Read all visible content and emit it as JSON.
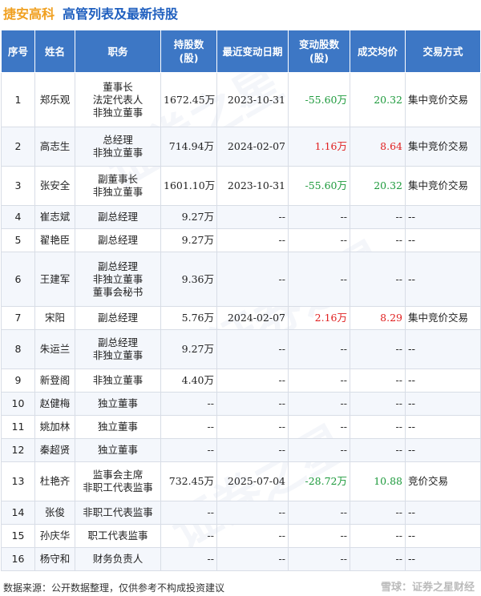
{
  "header": {
    "company": "捷安高科",
    "subtitle": "高管列表及最新持股"
  },
  "columns": [
    "序号",
    "姓名",
    "职务",
    "持股数\n(股)",
    "最近变动日期",
    "变动股数\n(股)",
    "成交均价",
    "交易方式"
  ],
  "rows": [
    {
      "idx": "1",
      "name": "郑乐观",
      "duties": "董事长\n法定代表人\n非独立董事",
      "shares": "1672.45万",
      "date": "2023-10-31",
      "chg": "-55.60万",
      "chg_sign": "neg",
      "price": "20.32",
      "method": "集中竞价交易"
    },
    {
      "idx": "2",
      "name": "高志生",
      "duties": "总经理\n非独立董事",
      "shares": "714.94万",
      "date": "2024-02-07",
      "chg": "1.16万",
      "chg_sign": "pos",
      "price": "8.64",
      "method": "集中竞价交易"
    },
    {
      "idx": "3",
      "name": "张安全",
      "duties": "副董事长\n非独立董事",
      "shares": "1601.10万",
      "date": "2023-10-31",
      "chg": "-55.60万",
      "chg_sign": "neg",
      "price": "20.32",
      "method": "集中竞价交易"
    },
    {
      "idx": "4",
      "name": "崔志斌",
      "duties": "副总经理",
      "shares": "9.27万",
      "date": "--",
      "chg": "--",
      "chg_sign": "none",
      "price": "--",
      "method": "--"
    },
    {
      "idx": "5",
      "name": "翟艳臣",
      "duties": "副总经理",
      "shares": "9.27万",
      "date": "--",
      "chg": "--",
      "chg_sign": "none",
      "price": "--",
      "method": "--"
    },
    {
      "idx": "6",
      "name": "王建军",
      "duties": "副总经理\n非独立董事\n董事会秘书",
      "shares": "9.36万",
      "date": "--",
      "chg": "--",
      "chg_sign": "none",
      "price": "--",
      "method": "--"
    },
    {
      "idx": "7",
      "name": "宋阳",
      "duties": "副总经理",
      "shares": "5.76万",
      "date": "2024-02-07",
      "chg": "2.16万",
      "chg_sign": "pos",
      "price": "8.29",
      "method": "集中竞价交易"
    },
    {
      "idx": "8",
      "name": "朱运兰",
      "duties": "副总经理\n非独立董事",
      "shares": "9.27万",
      "date": "--",
      "chg": "--",
      "chg_sign": "none",
      "price": "--",
      "method": "--"
    },
    {
      "idx": "9",
      "name": "新登阁",
      "duties": "非独立董事",
      "shares": "4.40万",
      "date": "--",
      "chg": "--",
      "chg_sign": "none",
      "price": "--",
      "method": "--"
    },
    {
      "idx": "10",
      "name": "赵健梅",
      "duties": "独立董事",
      "shares": "--",
      "date": "--",
      "chg": "--",
      "chg_sign": "none",
      "price": "--",
      "method": "--"
    },
    {
      "idx": "11",
      "name": "姚加林",
      "duties": "独立董事",
      "shares": "--",
      "date": "--",
      "chg": "--",
      "chg_sign": "none",
      "price": "--",
      "method": "--"
    },
    {
      "idx": "12",
      "name": "秦超贤",
      "duties": "独立董事",
      "shares": "--",
      "date": "--",
      "chg": "--",
      "chg_sign": "none",
      "price": "--",
      "method": "--"
    },
    {
      "idx": "13",
      "name": "杜艳齐",
      "duties": "监事会主席\n非职工代表监事",
      "shares": "732.45万",
      "date": "2025-07-04",
      "chg": "-28.72万",
      "chg_sign": "neg",
      "price": "10.88",
      "method": "竞价交易"
    },
    {
      "idx": "14",
      "name": "张俊",
      "duties": "非职工代表监事",
      "shares": "--",
      "date": "--",
      "chg": "--",
      "chg_sign": "none",
      "price": "--",
      "method": "--"
    },
    {
      "idx": "15",
      "name": "孙庆华",
      "duties": "职工代表监事",
      "shares": "--",
      "date": "--",
      "chg": "--",
      "chg_sign": "none",
      "price": "--",
      "method": "--"
    },
    {
      "idx": "16",
      "name": "杨守和",
      "duties": "财务负责人",
      "shares": "--",
      "date": "--",
      "chg": "--",
      "chg_sign": "none",
      "price": "--",
      "method": "--"
    }
  ],
  "footer": {
    "source": "数据来源：公开数据整理，仅供参考不构成投资建议",
    "brand": "雪球：证券之星财经"
  },
  "watermark_text": "证券之星"
}
